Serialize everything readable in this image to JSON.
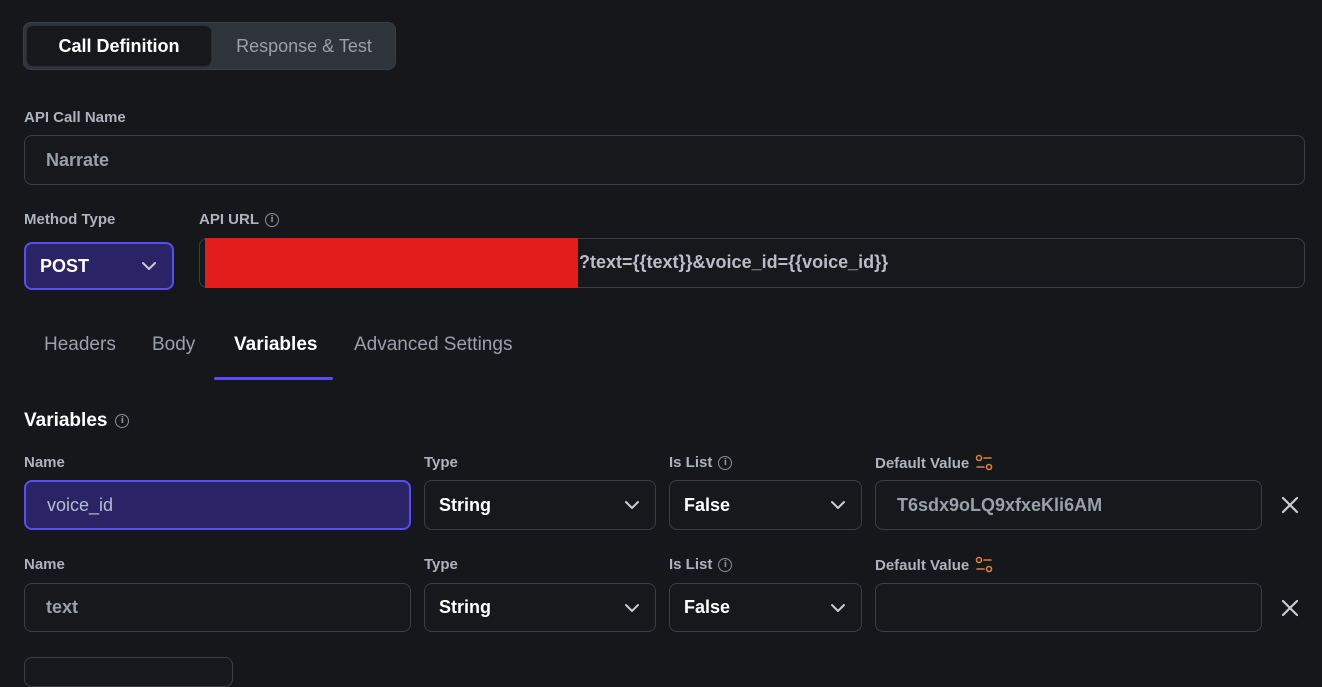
{
  "tabs_top": {
    "call_definition": "Call Definition",
    "response_test": "Response & Test"
  },
  "api_call_name": {
    "label": "API Call Name",
    "value": "Narrate"
  },
  "method": {
    "label": "Method Type",
    "value": "POST"
  },
  "api_url": {
    "label": "API URL",
    "value_suffix": "?text={{text}}&voice_id={{voice_id}}"
  },
  "sub_tabs": {
    "headers": "Headers",
    "body": "Body",
    "variables": "Variables",
    "advanced": "Advanced Settings"
  },
  "variables_section": {
    "title": "Variables",
    "rows": [
      {
        "name_label": "Name",
        "name_value": "voice_id",
        "type_label": "Type",
        "type_value": "String",
        "islist_label": "Is List",
        "islist_value": "False",
        "default_label": "Default Value",
        "default_value": "T6sdx9oLQ9xfxeKli6AM"
      },
      {
        "name_label": "Name",
        "name_value": "text",
        "type_label": "Type",
        "type_value": "String",
        "islist_label": "Is List",
        "islist_value": "False",
        "default_label": "Default Value",
        "default_value": ""
      }
    ]
  },
  "colors": {
    "accent": "#5a4cf0",
    "redaction": "#e31c1c",
    "tune_icon": "#d9823b"
  }
}
